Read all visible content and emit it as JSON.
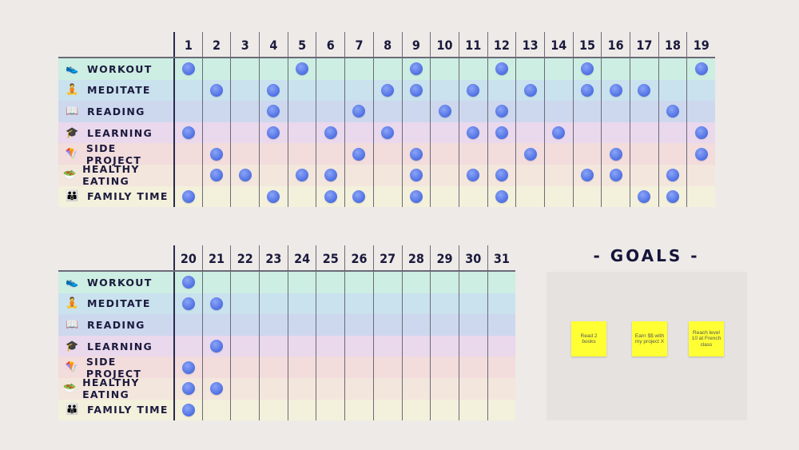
{
  "habits": [
    {
      "name": "WORKOUT",
      "icon": "👟",
      "icon_name": "sneaker-icon",
      "color": "#cdeee2"
    },
    {
      "name": "MEDITATE",
      "icon": "🧘",
      "icon_name": "meditation-icon",
      "color": "#c9e2ee"
    },
    {
      "name": "READING",
      "icon": "📖",
      "icon_name": "open-book-icon",
      "color": "#cdd8ee"
    },
    {
      "name": "LEARNING",
      "icon": "🎓",
      "icon_name": "graduation-cap-icon",
      "color": "#ead8ec"
    },
    {
      "name": "SIDE PROJECT",
      "icon": "🪁",
      "icon_name": "kite-icon",
      "color": "#f2dcdc"
    },
    {
      "name": "HEALTHY EATING",
      "icon": "🥗",
      "icon_name": "salad-icon",
      "color": "#f3e6dc"
    },
    {
      "name": "FAMILY TIME",
      "icon": "👪",
      "icon_name": "family-icon",
      "color": "#f3f0dc"
    }
  ],
  "top_days": [
    1,
    2,
    3,
    4,
    5,
    6,
    7,
    8,
    9,
    10,
    11,
    12,
    13,
    14,
    15,
    16,
    17,
    18,
    19
  ],
  "bottom_days": [
    20,
    21,
    22,
    23,
    24,
    25,
    26,
    27,
    28,
    29,
    30,
    31
  ],
  "completed": {
    "WORKOUT": [
      1,
      5,
      9,
      12,
      15,
      19,
      20
    ],
    "MEDITATE": [
      2,
      4,
      8,
      9,
      11,
      13,
      15,
      16,
      17,
      20,
      21
    ],
    "READING": [
      4,
      7,
      10,
      12,
      18
    ],
    "LEARNING": [
      1,
      4,
      6,
      8,
      11,
      12,
      14,
      19,
      21
    ],
    "SIDE PROJECT": [
      2,
      7,
      9,
      13,
      16,
      19,
      20
    ],
    "HEALTHY EATING": [
      2,
      3,
      5,
      6,
      9,
      11,
      12,
      15,
      16,
      18,
      20,
      21
    ],
    "FAMILY TIME": [
      1,
      4,
      6,
      7,
      9,
      12,
      17,
      18,
      20
    ]
  },
  "goals": {
    "title": "- GOALS -",
    "notes": [
      "Read 2 books",
      "Earn $$ with my project X",
      "Reach level 10 at French class"
    ],
    "note_color": "#ffff33"
  },
  "dot_color": "#5b7be8"
}
